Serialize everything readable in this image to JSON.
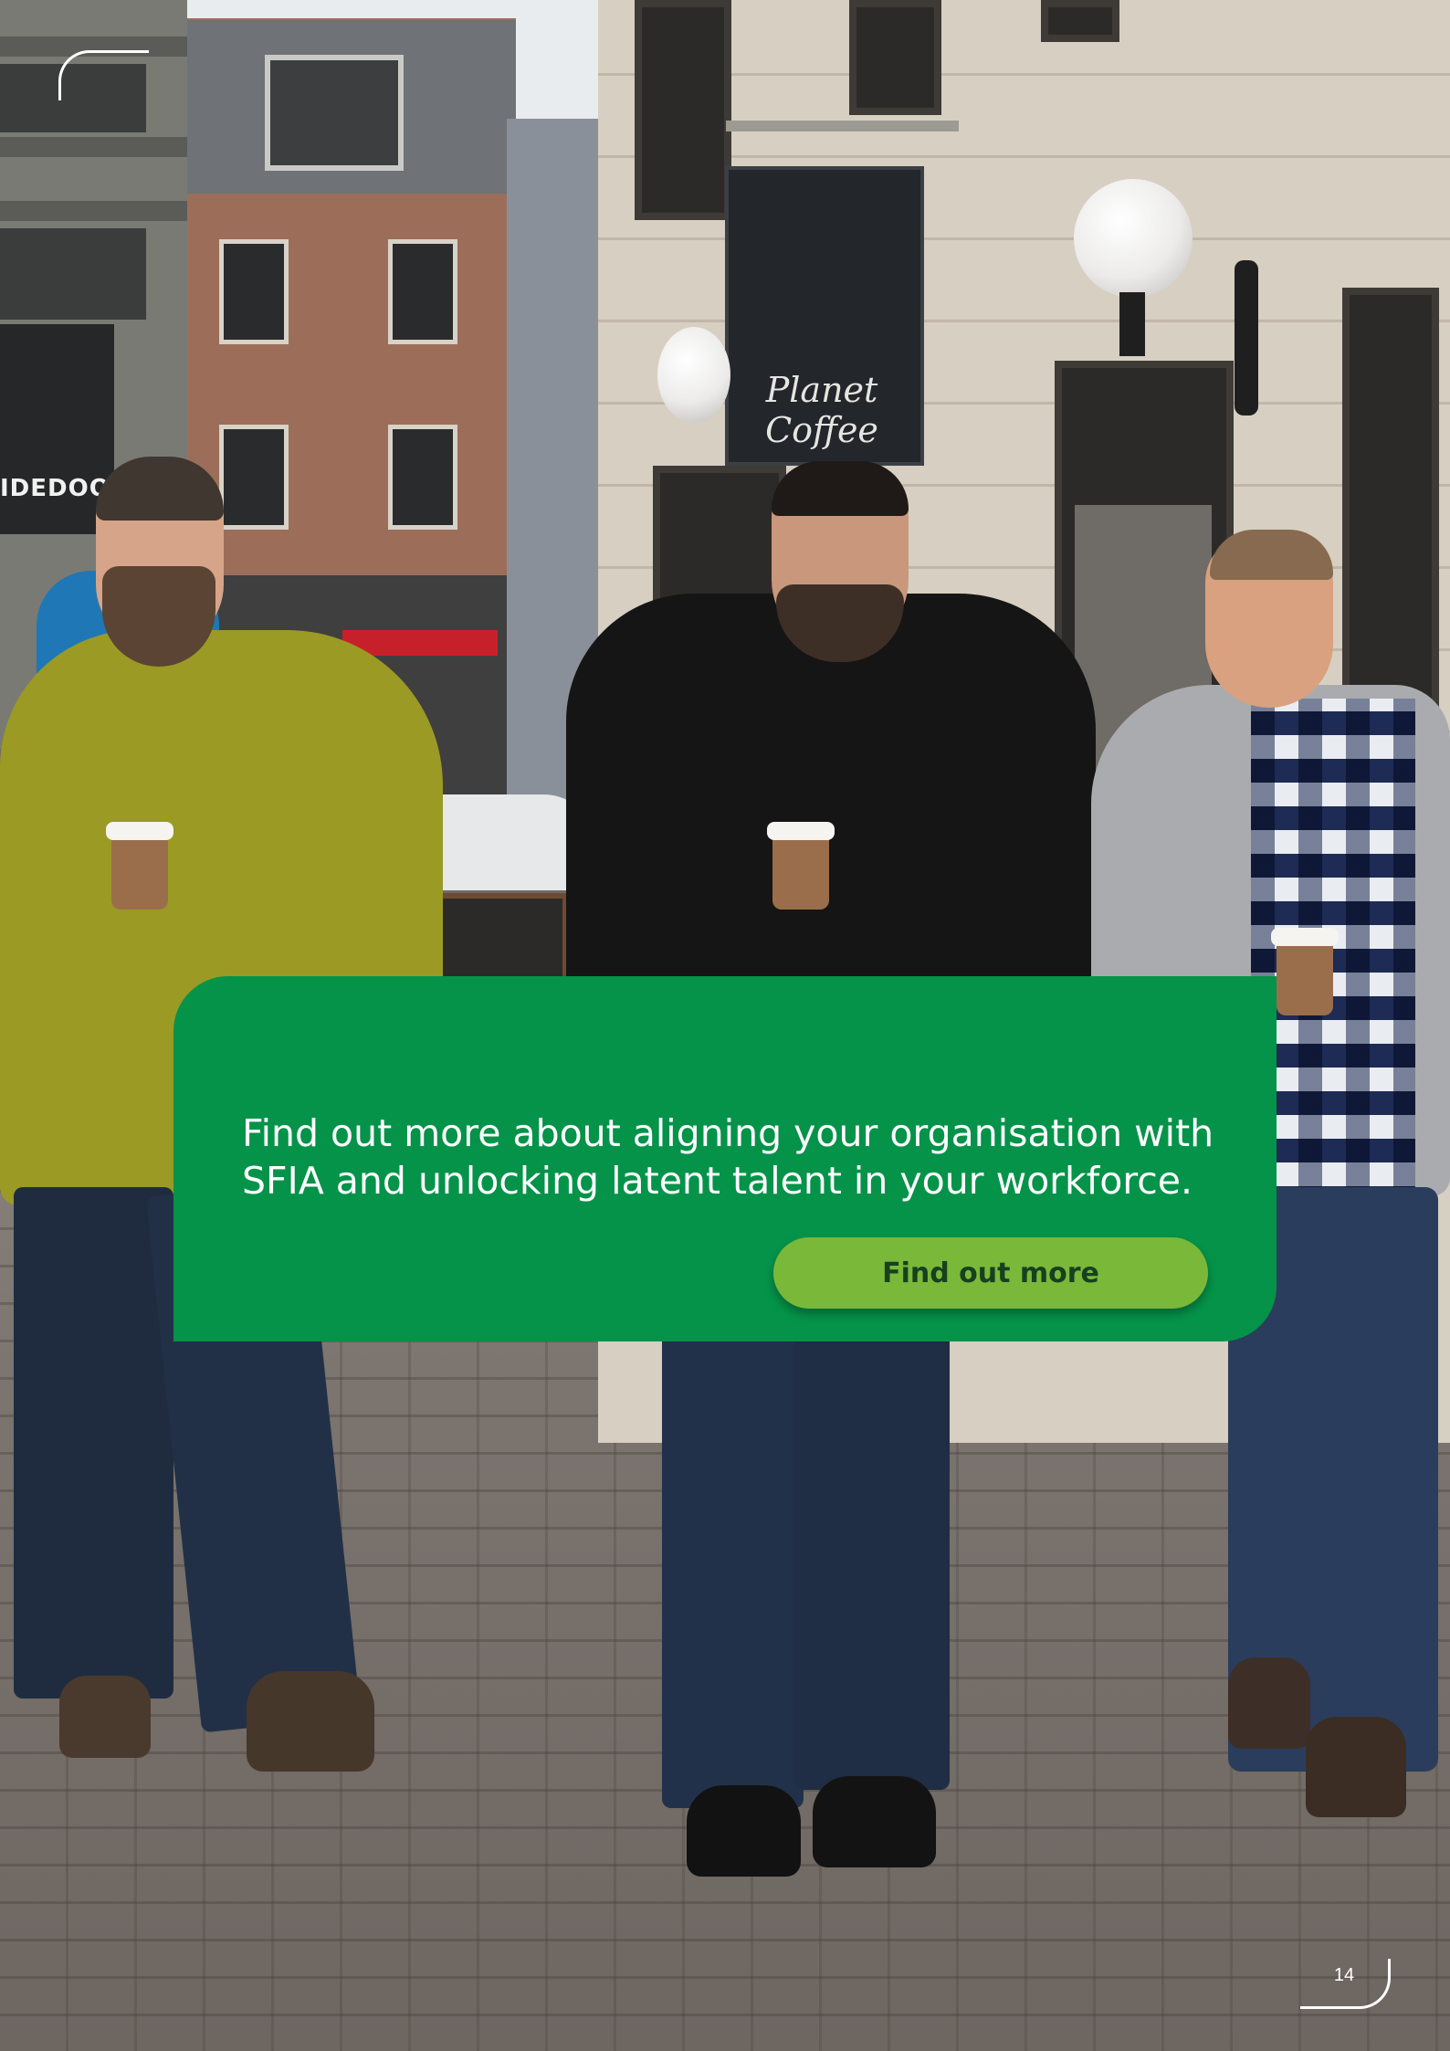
{
  "photo": {
    "shop_sign": "Planet Coffee",
    "awning_text": "IDEDOOR"
  },
  "cta": {
    "text": "Find out more about aligning your organisation with SFIA and unlocking latent talent in your workforce.",
    "button_label": "Find out more"
  },
  "footer": {
    "page_number": "14"
  },
  "colors": {
    "panel_green": "#059349",
    "button_green": "#7ab83a",
    "button_text": "#17401f"
  }
}
